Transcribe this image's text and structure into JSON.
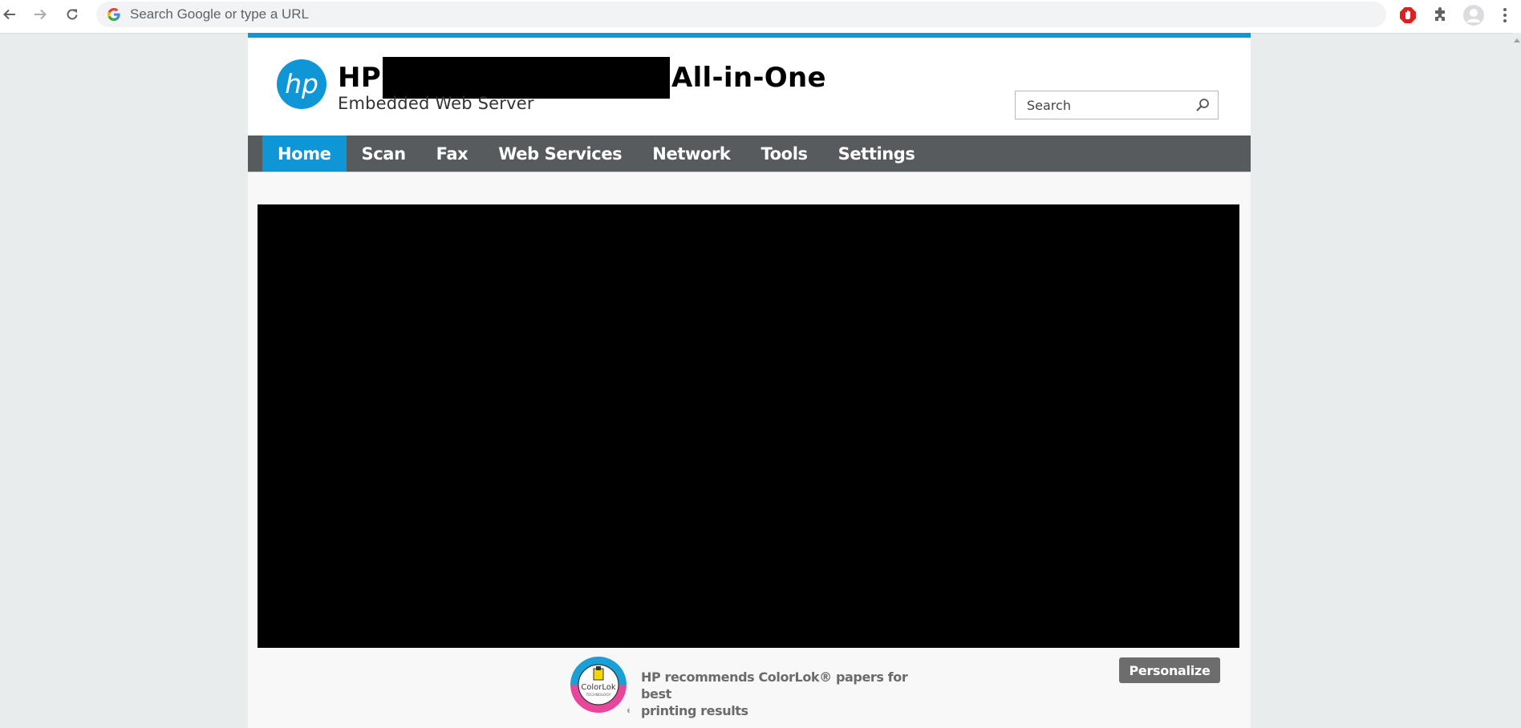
{
  "browser": {
    "omnibox_placeholder": "Search Google or type a URL"
  },
  "header": {
    "title_prefix": "HP",
    "title_suffix": "All-in-One",
    "subtitle": "Embedded Web Server",
    "search_placeholder": "Search"
  },
  "nav": {
    "tabs": [
      {
        "label": "Home",
        "active": true
      },
      {
        "label": "Scan"
      },
      {
        "label": "Fax"
      },
      {
        "label": "Web Services"
      },
      {
        "label": "Network"
      },
      {
        "label": "Tools"
      },
      {
        "label": "Settings"
      }
    ]
  },
  "footer": {
    "colorlok_logo_text": "ColorLok",
    "colorlok_logo_subtext": "TECHNOLOGY",
    "colorlok_line1": "HP recommends ColorLok® papers for best",
    "colorlok_line2": "printing results",
    "personalize_label": "Personalize"
  },
  "colors": {
    "accent": "#0f96d7",
    "navbar": "#575b5d",
    "button": "#6d6d6d"
  },
  "icons": [
    "back-icon",
    "forward-icon",
    "reload-icon",
    "google-icon",
    "adblock-icon",
    "extensions-icon",
    "profile-icon",
    "menu-icon",
    "hp-logo",
    "search-icon",
    "colorlok-logo"
  ]
}
